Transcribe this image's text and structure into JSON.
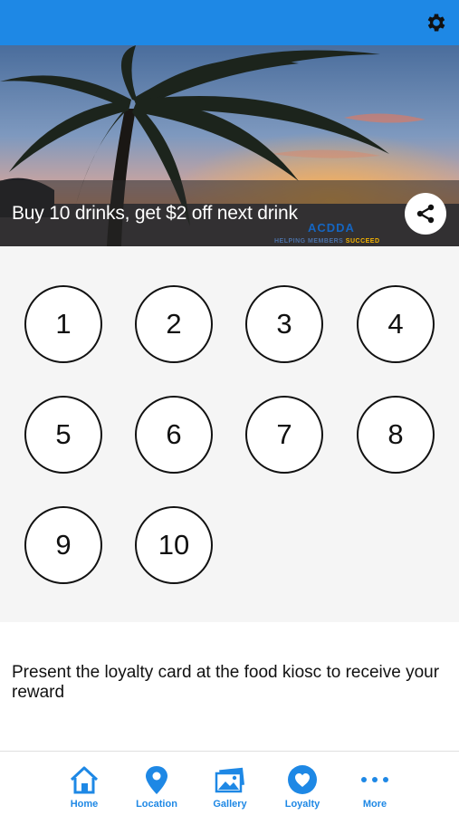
{
  "colors": {
    "accent": "#1e88e5",
    "stamp_border": "#111111",
    "stamp_area_bg": "#f5f5f5"
  },
  "header": {
    "settings_icon": "gear-icon"
  },
  "hero": {
    "title": "Buy 10 drinks, get $2 off next drink",
    "watermark_logo": "ACDDA",
    "watermark_tagline_part1": "HELPING MEMBERS ",
    "watermark_tagline_part2": "SUCCEED",
    "share_icon": "share-icon"
  },
  "stamps": [
    "1",
    "2",
    "3",
    "4",
    "5",
    "6",
    "7",
    "8",
    "9",
    "10"
  ],
  "description": "Present the loyalty card at the food kiosc to receive your reward",
  "tabbar": {
    "items": [
      {
        "label": "Home",
        "icon": "home-icon"
      },
      {
        "label": "Location",
        "icon": "location-pin-icon"
      },
      {
        "label": "Gallery",
        "icon": "gallery-icon"
      },
      {
        "label": "Loyalty",
        "icon": "heart-icon"
      },
      {
        "label": "More",
        "icon": "more-dots-icon"
      }
    ]
  }
}
